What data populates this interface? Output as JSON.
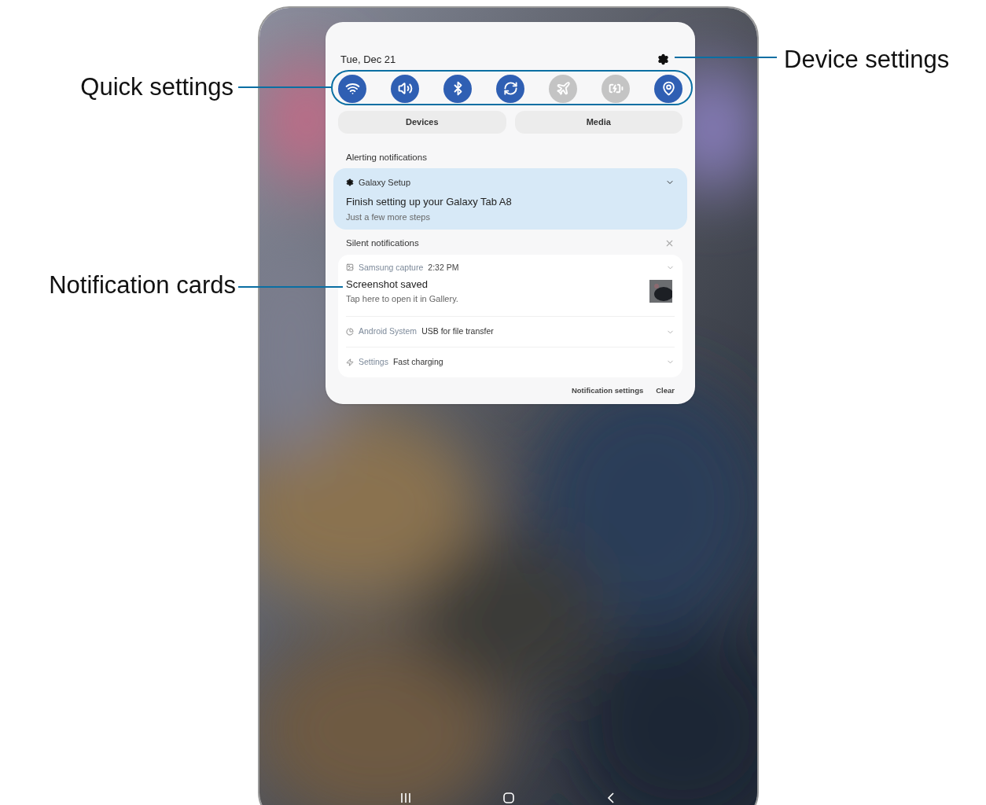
{
  "callouts": {
    "left": [
      {
        "label": "Quick settings"
      },
      {
        "label": "Notification cards"
      }
    ],
    "right": [
      {
        "label": "Device settings"
      }
    ]
  },
  "panel": {
    "date": "Tue, Dec 21",
    "quick_tiles": [
      {
        "kind": "wifi",
        "on": true
      },
      {
        "kind": "sound",
        "on": true
      },
      {
        "kind": "bluetooth",
        "on": true
      },
      {
        "kind": "rotate",
        "on": true
      },
      {
        "kind": "airplane",
        "on": false
      },
      {
        "kind": "battery",
        "on": false
      },
      {
        "kind": "location",
        "on": true
      }
    ],
    "buttons": [
      "Devices",
      "Media"
    ],
    "alerting": {
      "heading": "Alerting notifications",
      "card": {
        "app": "Galaxy Setup",
        "title": "Finish setting up your Galaxy Tab A8",
        "text": "Just a few more steps"
      }
    },
    "silent": {
      "heading": "Silent notifications",
      "items": [
        {
          "kind": "full",
          "app": "Samsung capture",
          "time": "2:32 PM",
          "title": "Screenshot saved",
          "text": "Tap here to open it in Gallery."
        },
        {
          "kind": "compact",
          "app": "Android System",
          "title": "USB for file transfer"
        },
        {
          "kind": "compact",
          "app": "Settings",
          "title": "Fast charging"
        }
      ]
    },
    "footer": [
      "Notification settings",
      "Clear"
    ]
  }
}
